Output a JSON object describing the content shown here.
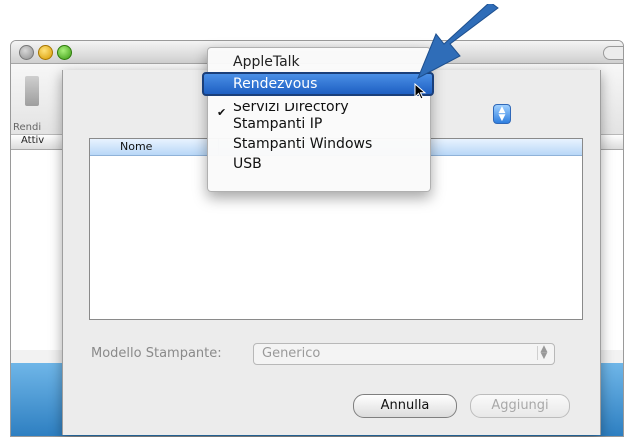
{
  "background_window": {
    "toolbar_label": "Rendi",
    "list_header": "Attiv"
  },
  "sheet": {
    "list": {
      "column_header": "Nome"
    },
    "printer_model": {
      "label": "Modello Stampante:",
      "value": "Generico"
    },
    "buttons": {
      "cancel": "Annulla",
      "add": "Aggiungi"
    }
  },
  "popup_menu": {
    "items": [
      {
        "label": "AppleTalk",
        "state": "normal"
      },
      {
        "label": "Rendezvous",
        "state": "highlighted"
      },
      {
        "label": "Servizi Directory",
        "state": "checked"
      },
      {
        "label": "Stampanti IP",
        "state": "normal"
      },
      {
        "label": "Stampanti Windows",
        "state": "normal"
      },
      {
        "label": "USB",
        "state": "normal"
      }
    ],
    "check_icon": "checkmark-icon"
  },
  "colors": {
    "highlight": "#1e5fc2",
    "callout_arrow": "#2f6db8",
    "bottom_band": "#2e7fc1"
  },
  "icons": [
    "mouse-pointer-icon",
    "callout-arrow-icon",
    "popup-arrows-icon"
  ]
}
